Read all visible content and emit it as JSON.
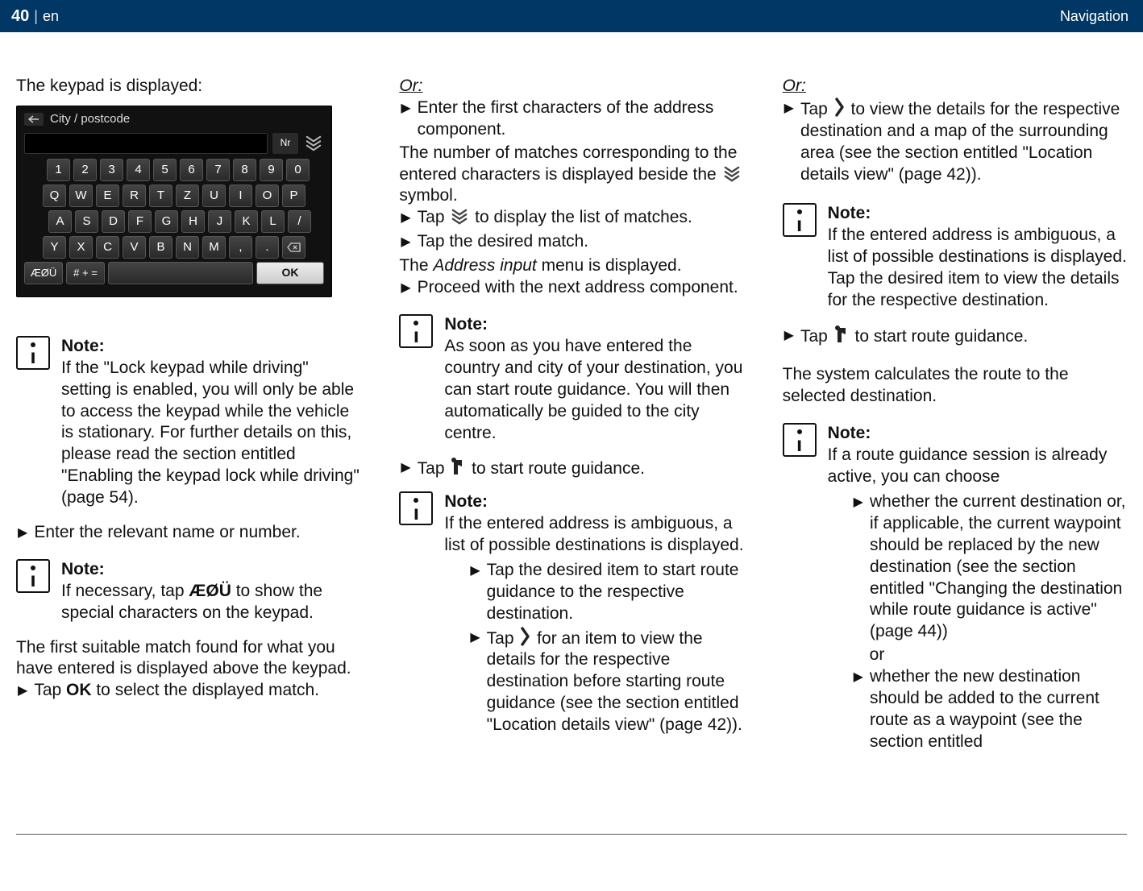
{
  "header": {
    "page_number": "40",
    "separator": "|",
    "lang": "en",
    "section": "Navigation"
  },
  "col1": {
    "intro": "The keypad is displayed:",
    "keypad": {
      "title": "City / postcode",
      "nr_label": "Nr",
      "row_nums": [
        "1",
        "2",
        "3",
        "4",
        "5",
        "6",
        "7",
        "8",
        "9",
        "0"
      ],
      "row_q": [
        "Q",
        "W",
        "E",
        "R",
        "T",
        "Z",
        "U",
        "I",
        "O",
        "P"
      ],
      "row_a": [
        "A",
        "S",
        "D",
        "F",
        "G",
        "H",
        "J",
        "K",
        "L",
        "/"
      ],
      "row_y": [
        "Y",
        "X",
        "C",
        "V",
        "B",
        "N",
        "M",
        ",",
        "."
      ],
      "special": "ÆØÜ",
      "sym": "# + =",
      "ok": "OK"
    },
    "note1_title": "Note:",
    "note1_text": "If the \"Lock keypad while driving\" setting is enabled, you will only be able to access the keypad while the vehicle is stationary. For further details on this, please read the section entitled \"Enabling the keypad lock while driving\" (page 54).",
    "instr1": "Enter the relevant name or number.",
    "note2_title": "Note:",
    "note2_text_a": "If necessary, tap ",
    "note2_text_bold": "ÆØÜ",
    "note2_text_b": " to show the special characters on the keypad.",
    "para2": "The first suitable match found for what you have entered is displayed above the keypad.",
    "instr2_a": "Tap ",
    "instr2_bold": "OK",
    "instr2_b": " to select the displayed match."
  },
  "col2": {
    "or": "Or:",
    "instr1": "Enter the first characters of the address component.",
    "para1_a": "The number of matches corresponding to the entered characters is displayed beside the ",
    "para1_b": " symbol.",
    "instr2_a": "Tap ",
    "instr2_b": " to display the list of matches.",
    "instr3": "Tap the desired match.",
    "para2_a": "The ",
    "para2_italic": "Address input",
    "para2_b": " menu is displayed.",
    "instr4": "Proceed with the next address component.",
    "note1_title": "Note:",
    "note1_text": "As soon as you have entered the country and city of your destination, you can start route guidance. You will then automatically be guided to the city centre.",
    "instr5_a": "Tap ",
    "instr5_b": "  to start route guidance.",
    "note2_title": "Note:",
    "note2_text": "If the entered address is ambiguous, a list of possible destinations is displayed.",
    "note2_sub1": "Tap the desired item to start route guidance to the respective destination.",
    "note2_sub2_a": "Tap ",
    "note2_sub2_b": " for an item to view the details for the respective destination before starting route guidance (see the section entitled \"Location details view\" (page 42))."
  },
  "col3": {
    "or": "Or:",
    "instr1_a": "Tap ",
    "instr1_b": " to view the details for the respective destination and a map of the surrounding area (see the section entitled \"Location details view\" (page 42)).",
    "note1_title": "Note:",
    "note1_text": "If the entered address is ambiguous, a list of possible destinations is displayed. Tap the desired item to view the details for the respective destination.",
    "instr2_a": "Tap ",
    "instr2_b": "  to start route guidance.",
    "para1": "The system calculates the route to the selected destination.",
    "note2_title": "Note:",
    "note2_text": "If a route guidance session is already active, you can choose",
    "note2_sub1": "whether the current destination or, if applicable, the current waypoint should be replaced by the new destination (see the section entitled \"Changing the destination while route guidance is active\" (page 44))",
    "note2_or": "or",
    "note2_sub2": "whether the new destination should be added to the current route as a waypoint (see the section entitled"
  }
}
